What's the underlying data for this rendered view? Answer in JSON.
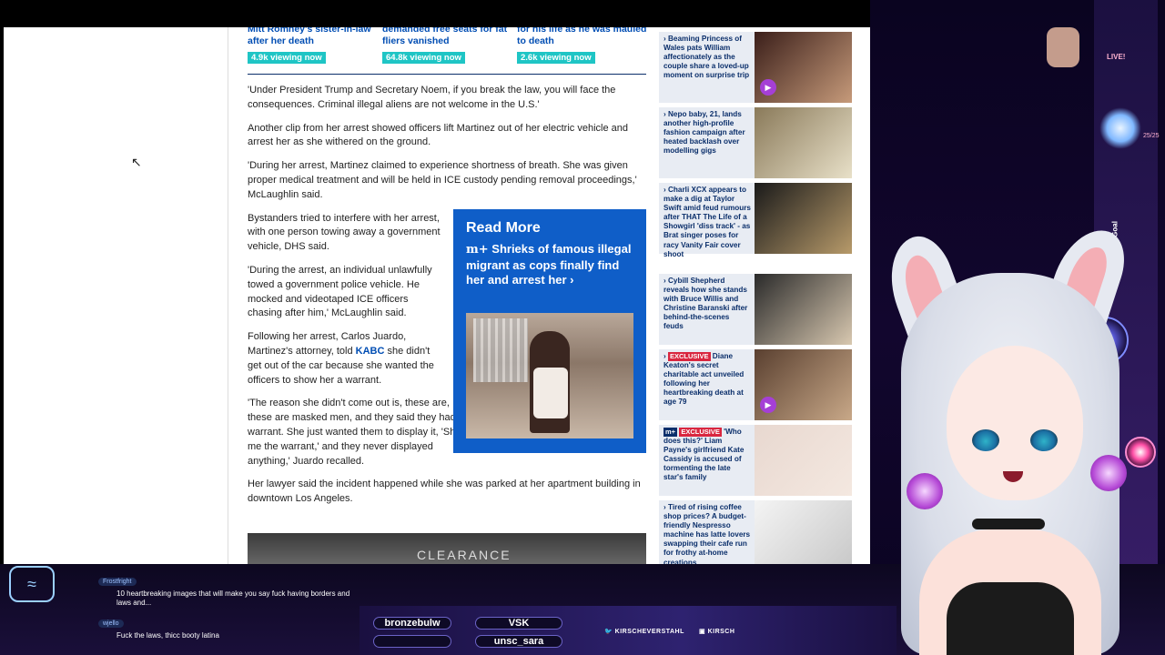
{
  "teasers": [
    {
      "title": "Mitt Romney's sister-in-law after her death",
      "viewing": "4.9k viewing now"
    },
    {
      "title": "demanded free seats for fat fliers vanished",
      "viewing": "64.8k viewing now"
    },
    {
      "title": "for his life as he was mauled to death",
      "viewing": "2.6k viewing now"
    }
  ],
  "article": {
    "p1": "'Under President Trump and Secretary Noem, if you break the law, you will face the consequences. Criminal illegal aliens are not welcome in the U.S.'",
    "p2": "Another clip from her arrest showed officers lift Martinez out of her electric vehicle and arrest her as she withered on the ground.",
    "p3": "'During her arrest, Martinez claimed to experience shortness of breath. She was given proper medical treatment and will be held in ICE custody pending removal proceedings,' McLaughlin said.",
    "p4": "Bystanders tried to interfere with her arrest, with one person towing away a government vehicle, DHS said.",
    "p5": "'During the arrest, an individual unlawfully towed a government police vehicle. He mocked and videotaped ICE officers chasing after him,' McLaughlin said.",
    "p6_before": "Following her arrest, Carlos Juardo, Martinez's attorney, told ",
    "p6_link": "KABC",
    "p6_after": " she didn't get out of the car because she wanted the officers to show her a warrant.",
    "p7": "'The reason she didn't come out is, these are, these are masked men, and they said they had a warrant. She just wanted them to display it, 'Show me the warrant,' and they never displayed anything,' Juardo recalled.",
    "p8": "Her lawyer said the incident happened while she was parked at her apartment building in downtown Los Angeles.",
    "video_text": "CLEARANCE"
  },
  "read_more": {
    "label": "Read More",
    "mplus": "m+",
    "headline": " Shrieks of famous illegal migrant as cops finally find her and arrest her ›"
  },
  "sidebar": [
    {
      "text": "Beaming Princess of Wales pats William affectionately as the couple share a loved-up moment on surprise trip",
      "badge": "",
      "play": true,
      "colors": [
        "#3b1f1a",
        "#c69a7a"
      ]
    },
    {
      "text": "Nepo baby, 21, lands another high-profile fashion campaign after heated backlash over modelling gigs",
      "badge": "",
      "play": false,
      "colors": [
        "#8a7a5a",
        "#e8e0c8"
      ]
    },
    {
      "text": "Charli XCX appears to make a dig at Taylor Swift amid feud rumours after THAT The Life of a Showgirl 'diss track' - as Brat singer poses for racy Vanity Fair cover shoot",
      "badge": "",
      "play": false,
      "colors": [
        "#1a1a1a",
        "#b79a6a"
      ]
    },
    {
      "text": "Cybill Shepherd reveals how she stands with Bruce Willis and Christine Baranski after behind-the-scenes feuds",
      "badge": "",
      "play": false,
      "colors": [
        "#2a2a2a",
        "#d8c8b0"
      ]
    },
    {
      "text": " Diane Keaton's secret charitable act unveiled following her heartbreaking death at age 79",
      "badge": "EXCLUSIVE",
      "play": true,
      "colors": [
        "#5a4030",
        "#c8a888"
      ]
    },
    {
      "text": " 'Who does this?' Liam Payne's girlfriend Kate Cassidy is accused of tormenting the late star's family",
      "badge": "EXCLUSIVE",
      "mplus": "m+",
      "play": false,
      "colors": [
        "#e8d8d0",
        "#f4e8e0"
      ]
    },
    {
      "text": "Tired of rising coffee shop prices? A budget-friendly Nespresso machine has latte lovers swapping their cafe run for frothy at-home creations",
      "badge": "",
      "play": false,
      "colors": [
        "#f4f4f4",
        "#c8c8c8"
      ]
    }
  ],
  "chat": [
    {
      "name": "Frostfright",
      "msg": "10 heartbreaking images that will make you say fuck having borders and laws and..."
    },
    {
      "name": "wjello",
      "msg": "Fuck the laws, thicc booty latina"
    }
  ],
  "credits": {
    "top_left": "bronzebulw",
    "top_right": "VSK",
    "bottom_right": "unsc_sara"
  },
  "social": {
    "twitter": "KIRSCHEVERSTAHL",
    "other": "KIRSCH"
  },
  "stream": {
    "live": "LIVE!",
    "count": "25/25",
    "sub_goal": "Daily Sub Goal"
  }
}
